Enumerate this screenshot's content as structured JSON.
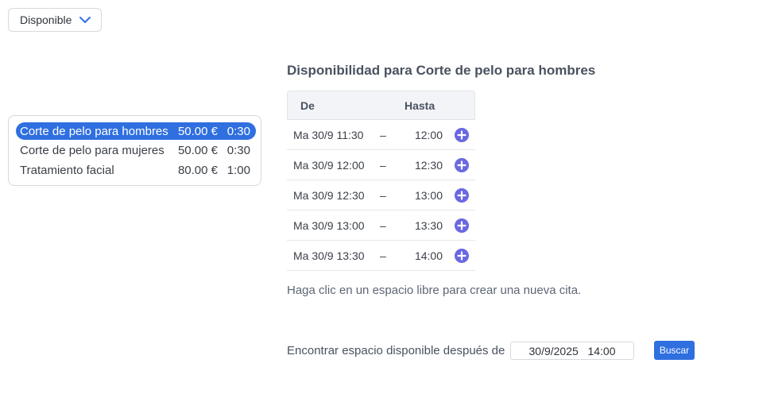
{
  "filter": {
    "selected": "Disponible"
  },
  "services": [
    {
      "name": "Corte de pelo para hombres",
      "price": "50.00 €",
      "duration": "0:30",
      "selected": true
    },
    {
      "name": "Corte de pelo para mujeres",
      "price": "50.00 €",
      "duration": "0:30",
      "selected": false
    },
    {
      "name": "Tratamiento facial",
      "price": "80.00 €",
      "duration": "1:00",
      "selected": false
    }
  ],
  "availability": {
    "title": "Disponibilidad para Corte de pelo para hombres",
    "headers": {
      "from": "De",
      "to": "Hasta"
    },
    "separator": "–",
    "slots": [
      {
        "from": "Ma 30/9 11:30",
        "to": "12:00"
      },
      {
        "from": "Ma 30/9 12:00",
        "to": "12:30"
      },
      {
        "from": "Ma 30/9 12:30",
        "to": "13:00"
      },
      {
        "from": "Ma 30/9 13:00",
        "to": "13:30"
      },
      {
        "from": "Ma 30/9 13:30",
        "to": "14:00"
      }
    ]
  },
  "help_text": "Haga clic en un espacio libre para crear una nueva cita.",
  "search": {
    "label": "Encontrar espacio disponible después de",
    "value": "30/9/2025   14:00",
    "button_label": "Buscar"
  },
  "colors": {
    "accent": "#2f6fe0",
    "add_icon": "#6a68e0"
  },
  "icons": {
    "dropdown": "chevron-down-icon",
    "add_slot": "plus-circle-icon"
  }
}
